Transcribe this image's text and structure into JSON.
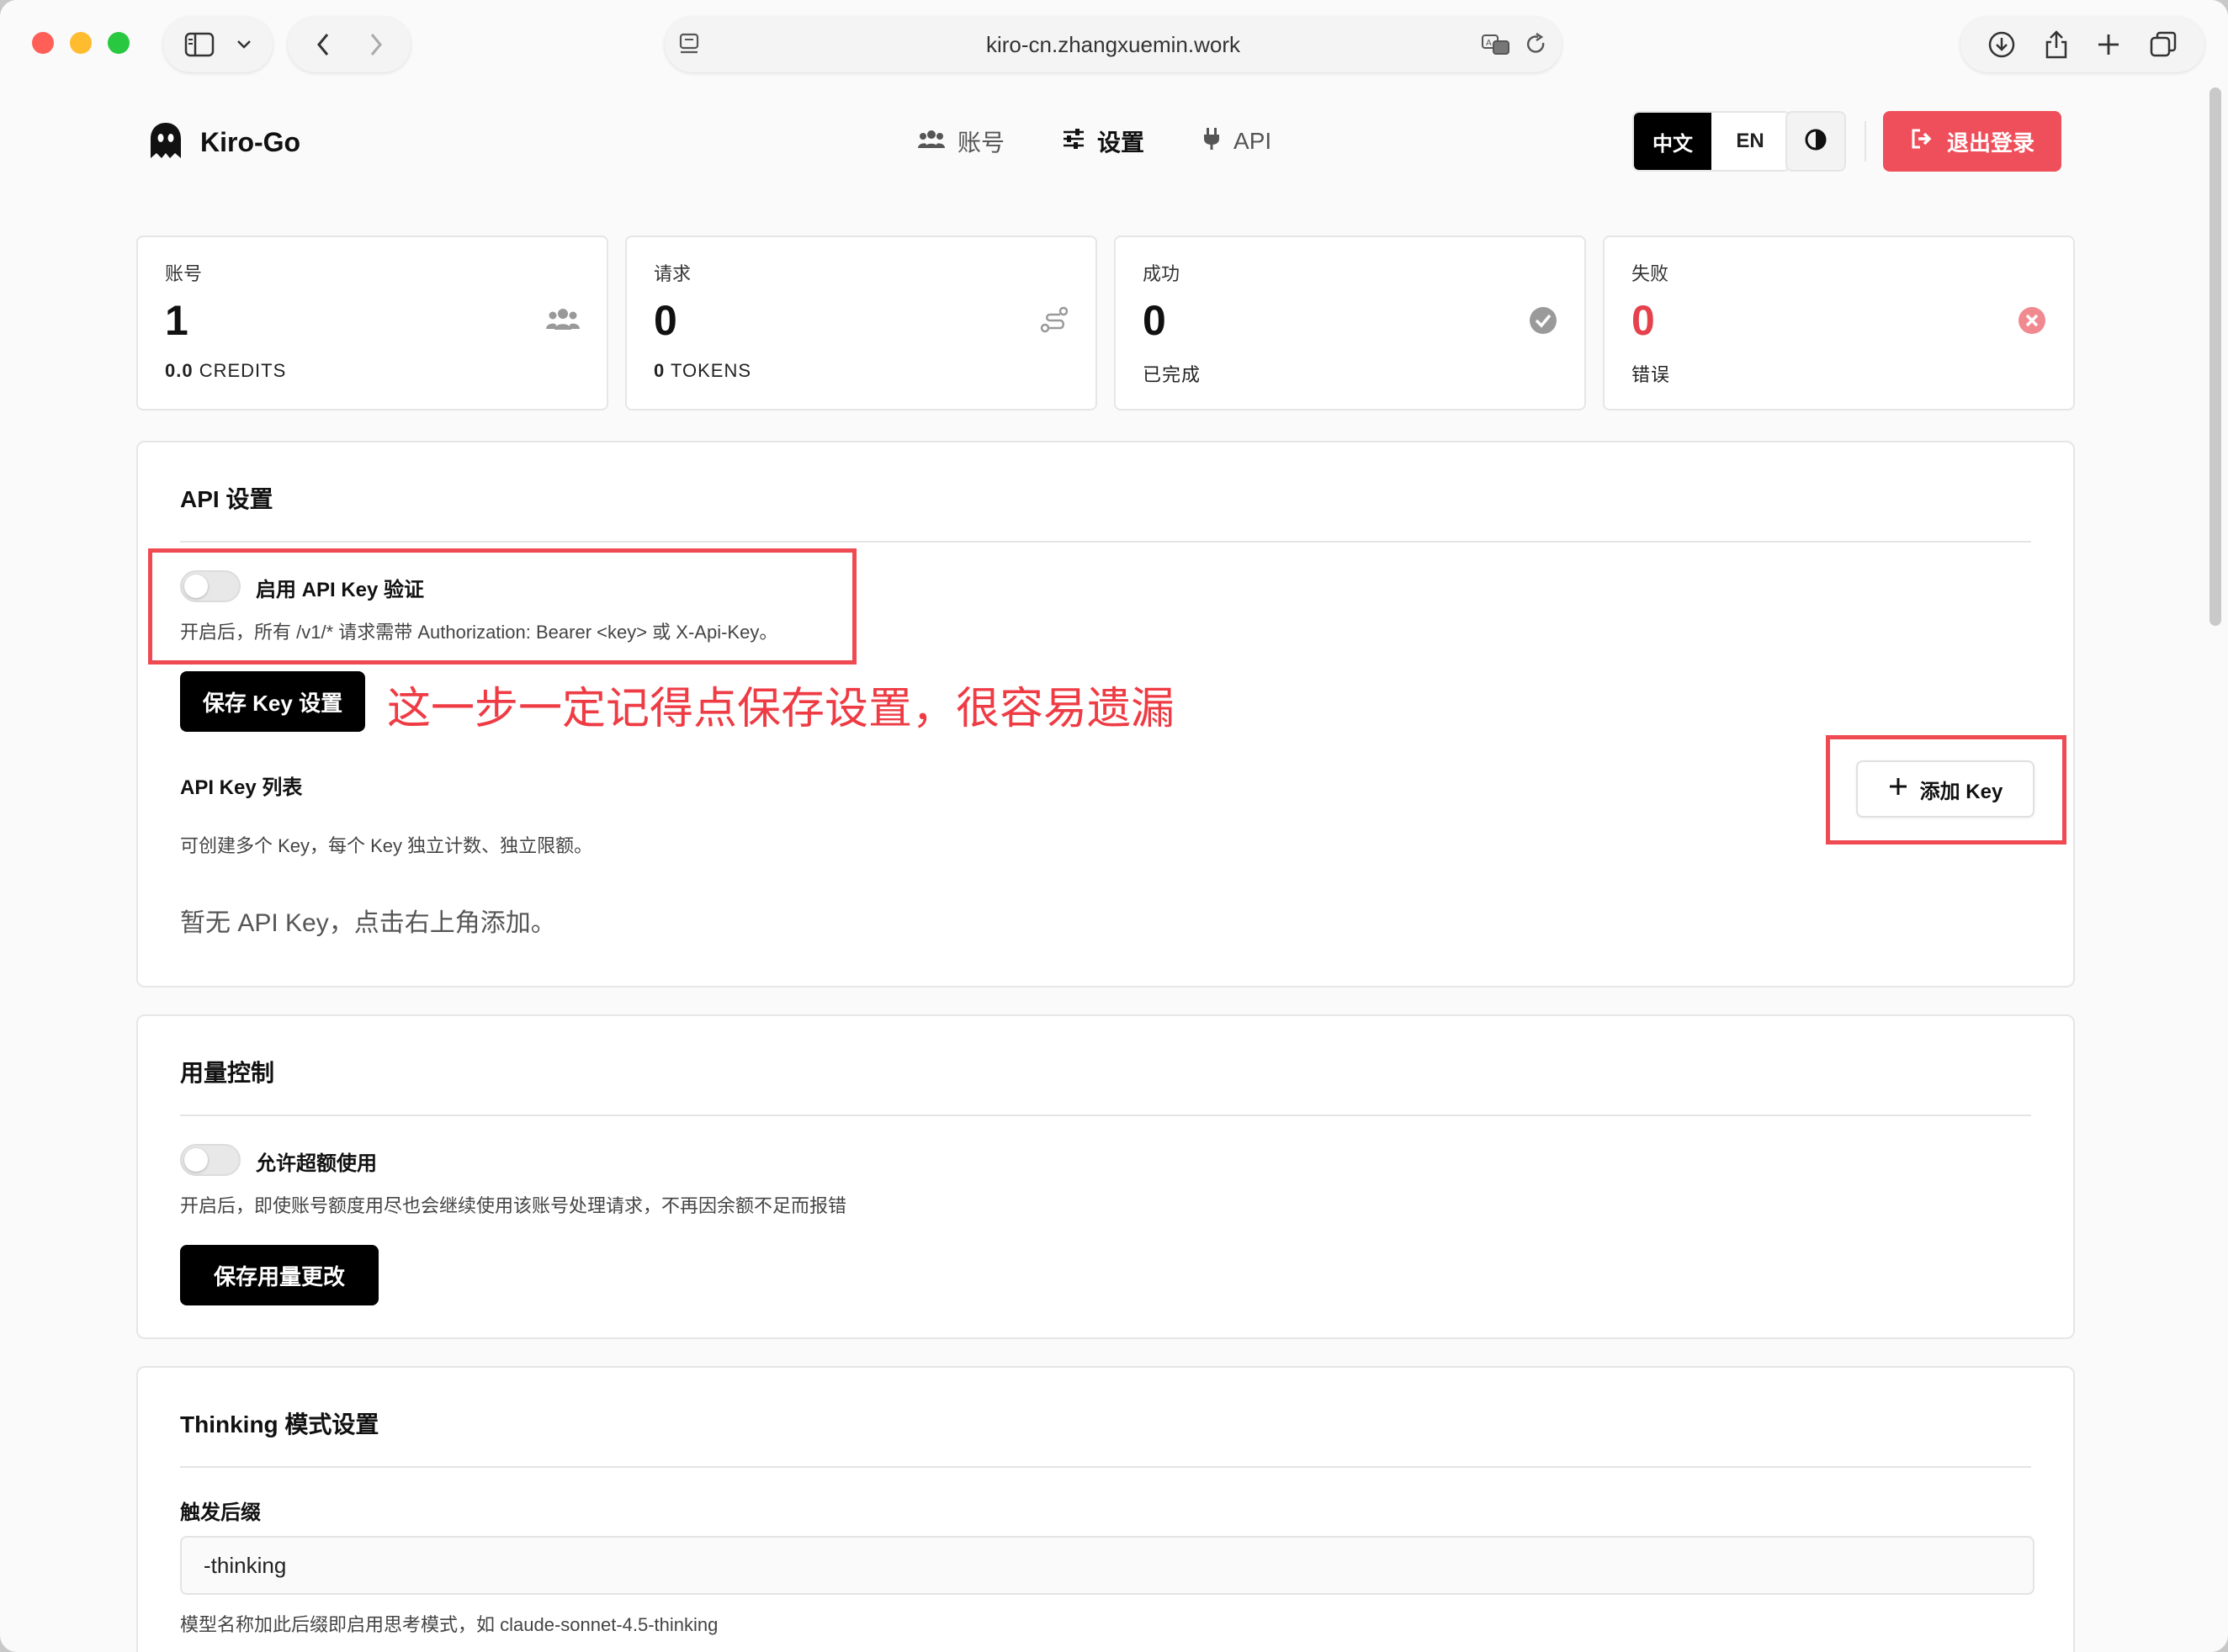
{
  "browser": {
    "url": "kiro-cn.zhangxuemin.work",
    "icons": [
      "sidebar-icon",
      "chevron-down-icon",
      "back-icon",
      "forward-icon",
      "page-icon",
      "translate-icon",
      "reload-icon",
      "download-icon",
      "share-icon",
      "plus-icon",
      "tabs-icon"
    ]
  },
  "header": {
    "brand": "Kiro-Go",
    "nav": [
      {
        "label": "账号",
        "icon": "users-icon"
      },
      {
        "label": "设置",
        "icon": "sliders-icon"
      },
      {
        "label": "API",
        "icon": "plug-icon"
      }
    ],
    "lang_zh": "中文",
    "lang_en": "EN",
    "logout_label": "退出登录"
  },
  "stats": [
    {
      "label": "账号",
      "value": "1",
      "sub_value": "0.0",
      "sub_label": "CREDITS",
      "icon": "users-icon"
    },
    {
      "label": "请求",
      "value": "0",
      "sub_value": "0",
      "sub_label": "TOKENS",
      "icon": "route-icon"
    },
    {
      "label": "成功",
      "value": "0",
      "sub_value": "",
      "sub_label": "已完成",
      "icon": "check-circle-icon"
    },
    {
      "label": "失败",
      "value": "0",
      "sub_value": "",
      "sub_label": "错误",
      "icon": "x-circle-icon"
    }
  ],
  "api_settings": {
    "title": "API 设置",
    "toggle_label": "启用 API Key 验证",
    "toggle_help": "开启后，所有 /v1/* 请求需带 Authorization: Bearer <key> 或 X-Api-Key。",
    "save_label": "保存 Key 设置",
    "annotation": "这一步一定记得点保存设置，很容易遗漏",
    "list_title": "API Key 列表",
    "list_help": "可创建多个 Key，每个 Key 独立计数、独立限额。",
    "add_label": "添加 Key",
    "empty_text": "暂无 API Key，点击右上角添加。"
  },
  "usage_control": {
    "title": "用量控制",
    "toggle_label": "允许超额使用",
    "toggle_help": "开启后，即使账号额度用尽也会继续使用该账号处理请求，不再因余额不足而报错",
    "save_label": "保存用量更改"
  },
  "thinking": {
    "title": "Thinking 模式设置",
    "suffix_label": "触发后缀",
    "suffix_value": "-thinking",
    "suffix_help": "模型名称加此后缀即启用思考模式，如 claude-sonnet-4.5-thinking"
  },
  "colors": {
    "accent_red": "#ef4f5a",
    "annotation_red": "#ee3b44",
    "primary_black": "#000000"
  }
}
